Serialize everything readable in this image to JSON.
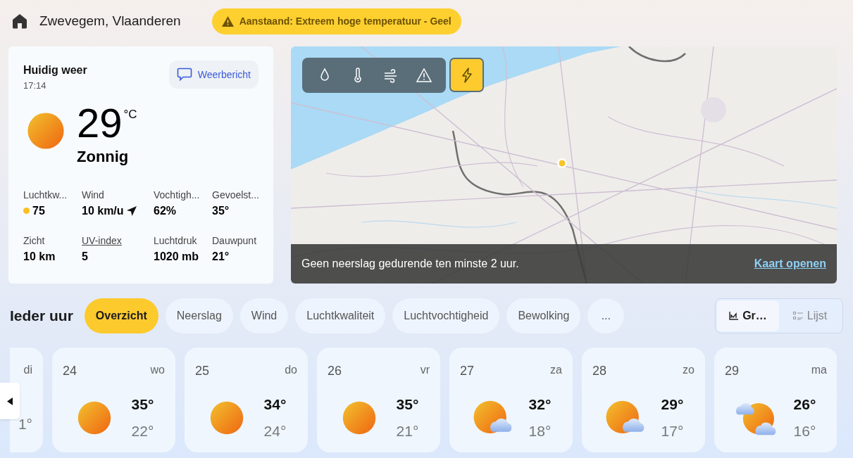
{
  "header": {
    "location": "Zwevegem, Vlaanderen",
    "alert": "Aanstaand: Extreem hoge temperatuur - Geel"
  },
  "current": {
    "title": "Huidig weer",
    "time": "17:14",
    "forecast_button": "Weerbericht",
    "temperature": "29",
    "unit": "°C",
    "condition": "Zonnig",
    "kind": "sunny",
    "details": [
      {
        "label": "Luchtkw...",
        "value": "75",
        "color": "#fbbf24",
        "link": false
      },
      {
        "label": "Wind",
        "value": "10 km/u",
        "arrow": true,
        "link": false
      },
      {
        "label": "Vochtigh...",
        "value": "62%",
        "link": false
      },
      {
        "label": "Gevoelst...",
        "value": "35°",
        "link": false
      },
      {
        "label": "Zicht",
        "value": "10 km",
        "link": false
      },
      {
        "label": "UV-index",
        "value": "5",
        "link": true
      },
      {
        "label": "Luchtdruk",
        "value": "1020 mb",
        "link": false
      },
      {
        "label": "Dauwpunt",
        "value": "21°",
        "link": false
      }
    ]
  },
  "map": {
    "kind": "picture",
    "layers": [
      {
        "kind": "drop",
        "selected": false
      },
      {
        "kind": "thermometer",
        "selected": false
      },
      {
        "kind": "wind",
        "selected": false
      },
      {
        "kind": "warning",
        "selected": false
      },
      {
        "kind": "lightning",
        "selected": true
      }
    ],
    "message": "Geen neerslag gedurende ten minste 2 uur.",
    "link": "Kaart openen"
  },
  "hourly": {
    "title": "Ieder uur",
    "tabs": [
      {
        "label": "Overzicht",
        "selected": true
      },
      {
        "label": "Neerslag",
        "selected": false
      },
      {
        "label": "Wind",
        "selected": false
      },
      {
        "label": "Luchtkwaliteit",
        "selected": false
      },
      {
        "label": "Luchtvochtigheid",
        "selected": false
      },
      {
        "label": "Bewolking",
        "selected": false
      },
      {
        "label": "...",
        "selected": false
      }
    ],
    "views": [
      {
        "label": "Gr…",
        "kind": "chart",
        "selected": true
      },
      {
        "label": "Lijst",
        "kind": "list",
        "selected": false
      }
    ]
  },
  "days": [
    {
      "weekday": "di",
      "low": "1°",
      "kind": "partial"
    },
    {
      "date": "24",
      "weekday": "wo",
      "high": "35°",
      "low": "22°",
      "kind": "sunny"
    },
    {
      "date": "25",
      "weekday": "do",
      "high": "34°",
      "low": "24°",
      "kind": "sunny"
    },
    {
      "date": "26",
      "weekday": "vr",
      "high": "35°",
      "low": "21°",
      "kind": "sunny"
    },
    {
      "date": "27",
      "weekday": "za",
      "high": "32°",
      "low": "18°",
      "kind": "partly_cloudy"
    },
    {
      "date": "28",
      "weekday": "zo",
      "high": "29°",
      "low": "17°",
      "kind": "partly_cloudy"
    },
    {
      "date": "29",
      "weekday": "ma",
      "high": "26°",
      "low": "16°",
      "kind": "mostly_cloudy"
    }
  ]
}
